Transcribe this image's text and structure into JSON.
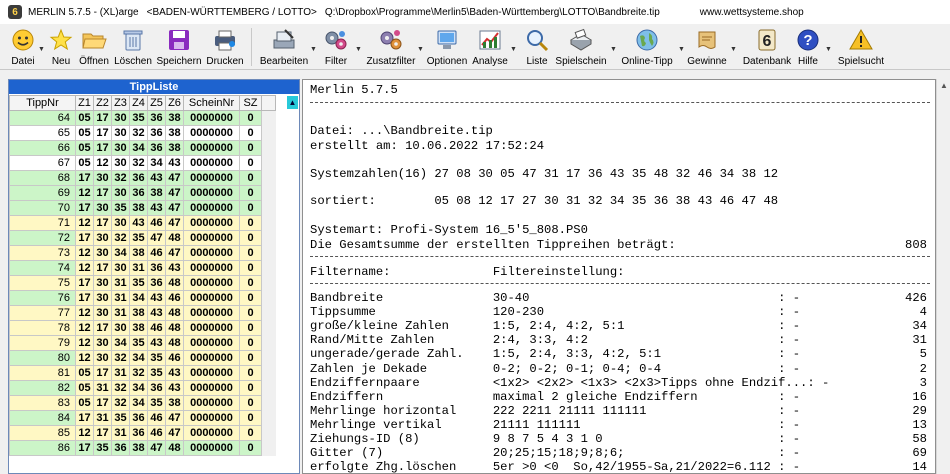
{
  "title": {
    "app": "MERLIN 5.7.5 - (XL)arge",
    "context": "<BADEN-WÜRTTEMBERG / LOTTO>",
    "path": "Q:\\Dropbox\\Programme\\Merlin5\\Baden-Württemberg\\LOTTO\\Bandbreite.tip",
    "site": "www.wettsysteme.shop"
  },
  "toolbar": {
    "datei": "Datei",
    "neu": "Neu",
    "oeffnen": "Öffnen",
    "loeschen": "Löschen",
    "speichern": "Speichern",
    "drucken": "Drucken",
    "bearbeiten": "Bearbeiten",
    "filter": "Filter",
    "zusatzfilter": "Zusatzfilter",
    "optionen": "Optionen",
    "analyse": "Analyse",
    "liste": "Liste",
    "spielschein": "Spielschein",
    "onlinetipp": "Online-Tipp",
    "gewinne": "Gewinne",
    "datenbank": "Datenbank",
    "hilfe": "Hilfe",
    "spielsucht": "Spielsucht"
  },
  "tippliste": {
    "title": "TippListe",
    "headers": [
      "TippNr",
      "Z1",
      "Z2",
      "Z3",
      "Z4",
      "Z5",
      "Z6",
      "ScheinNr",
      "SZ"
    ],
    "rows": [
      {
        "nr": "64",
        "z": [
          "05",
          "17",
          "30",
          "35",
          "36",
          "38"
        ],
        "schein": "0000000",
        "sz": "0"
      },
      {
        "nr": "65",
        "z": [
          "05",
          "17",
          "30",
          "32",
          "36",
          "38"
        ],
        "schein": "0000000",
        "sz": "0"
      },
      {
        "nr": "66",
        "z": [
          "05",
          "17",
          "30",
          "34",
          "36",
          "38"
        ],
        "schein": "0000000",
        "sz": "0"
      },
      {
        "nr": "67",
        "z": [
          "05",
          "12",
          "30",
          "32",
          "34",
          "43"
        ],
        "schein": "0000000",
        "sz": "0"
      },
      {
        "nr": "68",
        "z": [
          "17",
          "30",
          "32",
          "36",
          "43",
          "47"
        ],
        "schein": "0000000",
        "sz": "0"
      },
      {
        "nr": "69",
        "z": [
          "12",
          "17",
          "30",
          "36",
          "38",
          "47"
        ],
        "schein": "0000000",
        "sz": "0"
      },
      {
        "nr": "70",
        "z": [
          "17",
          "30",
          "35",
          "38",
          "43",
          "47"
        ],
        "schein": "0000000",
        "sz": "0"
      },
      {
        "nr": "71",
        "z": [
          "12",
          "17",
          "30",
          "43",
          "46",
          "47"
        ],
        "schein": "0000000",
        "sz": "0"
      },
      {
        "nr": "72",
        "z": [
          "17",
          "30",
          "32",
          "35",
          "47",
          "48"
        ],
        "schein": "0000000",
        "sz": "0"
      },
      {
        "nr": "73",
        "z": [
          "12",
          "30",
          "34",
          "38",
          "46",
          "47"
        ],
        "schein": "0000000",
        "sz": "0"
      },
      {
        "nr": "74",
        "z": [
          "12",
          "17",
          "30",
          "31",
          "36",
          "43"
        ],
        "schein": "0000000",
        "sz": "0"
      },
      {
        "nr": "75",
        "z": [
          "17",
          "30",
          "31",
          "35",
          "36",
          "48"
        ],
        "schein": "0000000",
        "sz": "0"
      },
      {
        "nr": "76",
        "z": [
          "17",
          "30",
          "31",
          "34",
          "43",
          "46"
        ],
        "schein": "0000000",
        "sz": "0"
      },
      {
        "nr": "77",
        "z": [
          "12",
          "30",
          "31",
          "38",
          "43",
          "48"
        ],
        "schein": "0000000",
        "sz": "0"
      },
      {
        "nr": "78",
        "z": [
          "12",
          "17",
          "30",
          "38",
          "46",
          "48"
        ],
        "schein": "0000000",
        "sz": "0"
      },
      {
        "nr": "79",
        "z": [
          "12",
          "30",
          "34",
          "35",
          "43",
          "48"
        ],
        "schein": "0000000",
        "sz": "0"
      },
      {
        "nr": "80",
        "z": [
          "12",
          "30",
          "32",
          "34",
          "35",
          "46"
        ],
        "schein": "0000000",
        "sz": "0"
      },
      {
        "nr": "81",
        "z": [
          "05",
          "17",
          "31",
          "32",
          "35",
          "43"
        ],
        "schein": "0000000",
        "sz": "0"
      },
      {
        "nr": "82",
        "z": [
          "05",
          "31",
          "32",
          "34",
          "36",
          "43"
        ],
        "schein": "0000000",
        "sz": "0"
      },
      {
        "nr": "83",
        "z": [
          "05",
          "17",
          "32",
          "34",
          "35",
          "38"
        ],
        "schein": "0000000",
        "sz": "0"
      },
      {
        "nr": "84",
        "z": [
          "17",
          "31",
          "35",
          "36",
          "46",
          "47"
        ],
        "schein": "0000000",
        "sz": "0"
      },
      {
        "nr": "85",
        "z": [
          "12",
          "17",
          "31",
          "36",
          "46",
          "47"
        ],
        "schein": "0000000",
        "sz": "0"
      },
      {
        "nr": "86",
        "z": [
          "17",
          "35",
          "36",
          "38",
          "47",
          "48"
        ],
        "schein": "0000000",
        "sz": "0"
      }
    ],
    "row_colors": [
      "#ccf5c8",
      "#ffffff",
      "#ccf5c8",
      "#ffffff",
      "#ccf5c8",
      "#ccf5c8",
      "#ccf5c8",
      "#fff8c4",
      "#fff8c4",
      "#fff8c4",
      "#fff8c4",
      "#fff8c4",
      "#fff8c4",
      "#fff8c4",
      "#fff8c4",
      "#fff8c4",
      "#fff8c4",
      "#fff8c4",
      "#fff8c4",
      "#fff8c4",
      "#fff8c4",
      "#fff8c4",
      "#ccf5c8"
    ],
    "nr_colors": [
      "#ccf5c8",
      "#ffffff",
      "#ccf5c8",
      "#ffffff",
      "#ccf5c8",
      "#ccf5c8",
      "#ccf5c8",
      "#fff8c4",
      "#ccf5c8",
      "#fff8c4",
      "#ccf5c8",
      "#fff8c4",
      "#ccf5c8",
      "#fff8c4",
      "#fff8c4",
      "#fff8c4",
      "#ccf5c8",
      "#fff8c4",
      "#ccf5c8",
      "#fff8c4",
      "#ccf5c8",
      "#fff8c4",
      "#ccf5c8"
    ]
  },
  "report": {
    "l1": "Merlin 5.7.5",
    "l2": "Datei: ...\\Bandbreite.tip",
    "l3": "erstellt am: 10.06.2022 17:52:24",
    "l4": "Systemzahlen(16) 27 08 30 05 47 31 17 36 43 35 48 32 46 34 38 12",
    "l5": "sortiert:        05 08 12 17 27 30 31 32 34 35 36 38 43 46 47 48",
    "l6": "Systemart: Profi-System 16_5'5_808.PS0",
    "l7": "Die Gesamtsumme der erstellten Tippreihen beträgt:",
    "l7v": "808",
    "l8": "Filtername:              Filtereinstellung:",
    "filters": [
      {
        "text": "Bandbreite               30-40                                  : -",
        "val": "426"
      },
      {
        "text": "Tippsumme                120-230                                : -",
        "val": "4"
      },
      {
        "text": "große/kleine Zahlen      1:5, 2:4, 4:2, 5:1                     : -",
        "val": "34"
      },
      {
        "text": "Rand/Mitte Zahlen        2:4, 3:3, 4:2                          : -",
        "val": "31"
      },
      {
        "text": "ungerade/gerade Zahl.    1:5, 2:4, 3:3, 4:2, 5:1                : -",
        "val": "5"
      },
      {
        "text": "Zahlen je Dekade         0-2; 0-2; 0-1; 0-4; 0-4                : -",
        "val": "2"
      },
      {
        "text": "Endziffernpaare          <1x2> <2x2> <1x3> <2x3>Tipps ohne Endzif...: -",
        "val": "3"
      },
      {
        "text": "Endziffern               maximal 2 gleiche Endziffern           : -",
        "val": "16"
      },
      {
        "text": "Mehrlinge horizontal     222 2211 21111 111111                  : -",
        "val": "29"
      },
      {
        "text": "Mehrlinge vertikal       21111 111111                           : -",
        "val": "13"
      },
      {
        "text": "Ziehungs-ID (8)          9 8 7 5 4 3 1 0                        : -",
        "val": "58"
      },
      {
        "text": "Gitter (7)               20;25;15;18;9;8;6;                     : -",
        "val": "69"
      },
      {
        "text": "erfolgte Zhg.löschen     5er >0 <0  So,42/1955-Sa,21/2022=6.112 : -",
        "val": "14"
      }
    ]
  },
  "colors": {
    "accent": "#1e63cf",
    "green_row": "#ccf5c8",
    "yellow_row": "#fff8c4",
    "scroll_marker": "#27c9d9"
  }
}
